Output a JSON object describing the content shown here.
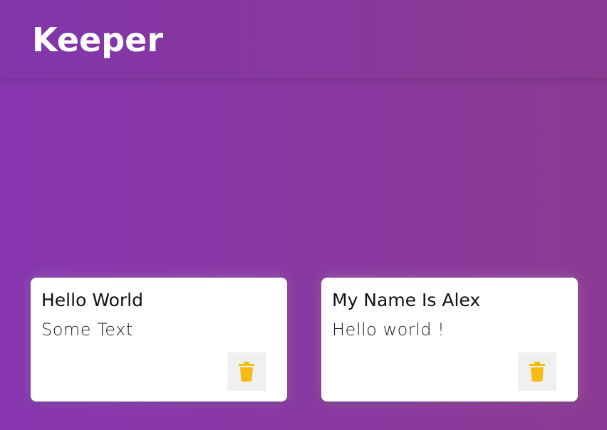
{
  "header": {
    "title": "Keeper"
  },
  "notes": [
    {
      "title": "Hello World",
      "content": "Some Text",
      "delete_icon": "trash-icon"
    },
    {
      "title": "My Name Is Alex",
      "content": "Hello world !",
      "delete_icon": "trash-icon"
    }
  ],
  "colors": {
    "background_start": "#8637b0",
    "background_end": "#8c3b93",
    "card": "#ffffff",
    "delete_button_bg": "#f0f0f0",
    "delete_icon": "#f5ba13"
  }
}
